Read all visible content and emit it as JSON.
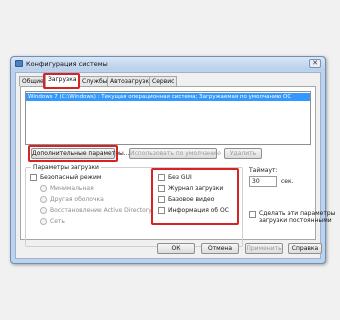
{
  "window": {
    "title": "Конфигурация системы",
    "close_glyph": "✕"
  },
  "tabs": [
    {
      "label": "Общие"
    },
    {
      "label": "Загрузка"
    },
    {
      "label": "Службы"
    },
    {
      "label": "Автозагрузка"
    },
    {
      "label": "Сервис"
    }
  ],
  "os_list": {
    "items": [
      "Windows 7 (C:\\Windows) : Текущая операционная система; Загружаемая по умолчанию ОС"
    ]
  },
  "buttons": {
    "advanced": "Дополнительные параметры...",
    "set_default": "Использовать по умолчанию",
    "delete": "Удалить"
  },
  "boot_options": {
    "legend": "Параметры загрузки",
    "safe_boot": "Безопасный режим",
    "minimal": "Минимальная",
    "alternate_shell": "Другая оболочка",
    "ad_repair": "Восстановление Active Directory",
    "network": "Сеть",
    "no_gui": "Без GUI",
    "boot_log": "Журнал загрузки",
    "base_video": "Базовое видео",
    "os_boot_info": "Информация об ОС"
  },
  "timeout": {
    "label": "Таймаут:",
    "value": "30",
    "unit": "сек."
  },
  "make_permanent": {
    "label_line1": "Сделать эти параметры",
    "label_line2": "загрузки постоянными"
  },
  "footer": {
    "ok": "ОК",
    "cancel": "Отмена",
    "apply": "Применить",
    "help": "Справка"
  },
  "colors": {
    "highlight": "#d62424",
    "selection": "#3399ff",
    "window_frame": "#bcd3ee"
  }
}
